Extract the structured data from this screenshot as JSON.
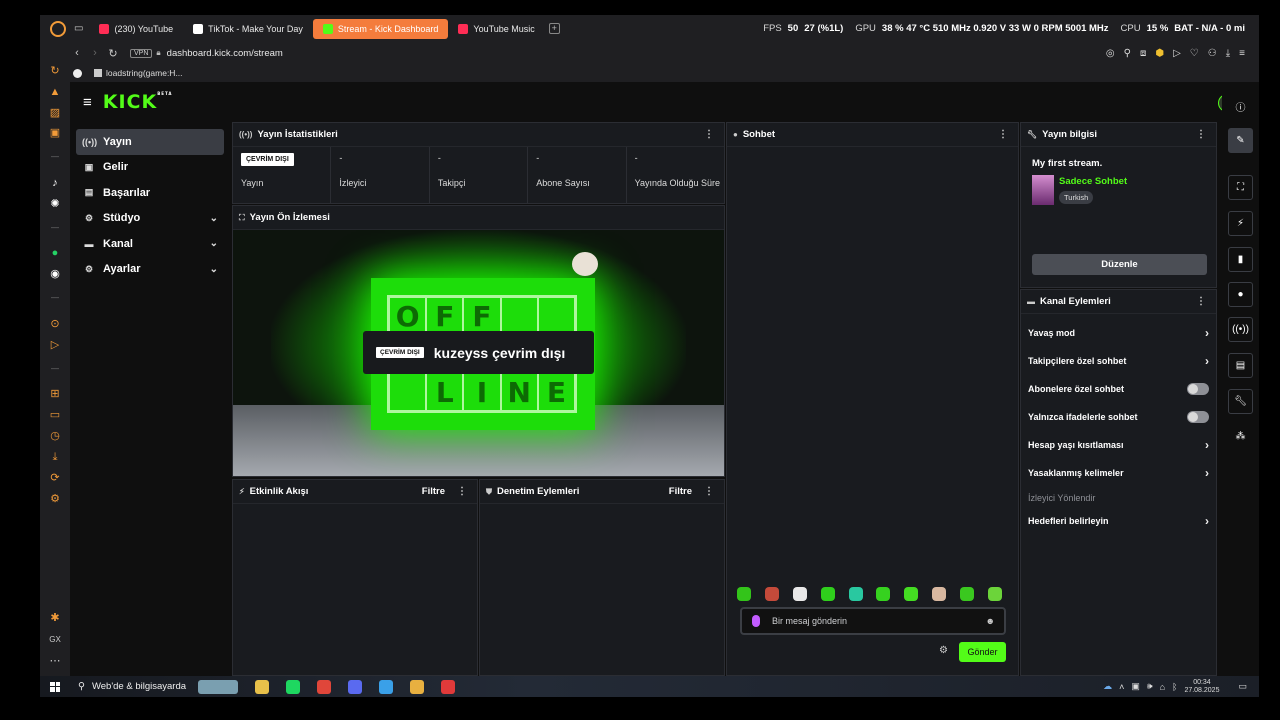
{
  "browser": {
    "tabs": [
      {
        "label": "(230) YouTube",
        "icon": "youtube-icon",
        "color": "#ff2d55",
        "active": false
      },
      {
        "label": "TikTok - Make Your Day",
        "icon": "tiktok-icon",
        "color": "#ffffff",
        "active": false
      },
      {
        "label": "Stream - Kick Dashboard",
        "icon": "kick-icon",
        "color": "#53fc18",
        "active": true
      },
      {
        "label": "YouTube Music",
        "icon": "youtube-music-icon",
        "color": "#ff2d55",
        "active": false
      }
    ],
    "add_tab": "+",
    "perf": {
      "fps_label": "FPS",
      "fps": "50",
      "fps_low": "27 (%1L)",
      "gpu_label": "GPU",
      "gpu": "38 % 47 °C 510 MHz 0.920 V 33 W 0 RPM 5001 MHz",
      "cpu_label": "CPU",
      "cpu": "15 %",
      "bat": "BAT - N/A - 0 mi"
    },
    "url": "dashboard.kick.com/stream",
    "vpn": "VPN",
    "bookmark": "loadstring(game:H..."
  },
  "kick": {
    "logo": "KICK",
    "logo_sup": "BETA",
    "nav": [
      {
        "label": "Yayın",
        "icon": "broadcast-icon",
        "active": true,
        "chevron": false
      },
      {
        "label": "Gelir",
        "icon": "dollar-icon",
        "active": false,
        "chevron": false
      },
      {
        "label": "Başarılar",
        "icon": "trophy-icon",
        "active": false,
        "chevron": false
      },
      {
        "label": "Stüdyo",
        "icon": "studio-icon",
        "active": false,
        "chevron": true
      },
      {
        "label": "Kanal",
        "icon": "channel-icon",
        "active": false,
        "chevron": true
      },
      {
        "label": "Ayarlar",
        "icon": "settings-icon",
        "active": false,
        "chevron": true
      }
    ],
    "stats": {
      "title": "Yayın İstatistikleri",
      "items": [
        {
          "value": "ÇEVRİM DIŞI",
          "label": "Yayın"
        },
        {
          "value": "-",
          "label": "İzleyici"
        },
        {
          "value": "-",
          "label": "Takipçi"
        },
        {
          "value": "-",
          "label": "Abone Sayısı"
        },
        {
          "value": "-",
          "label": "Yayında Olduğu Süre"
        }
      ]
    },
    "preview": {
      "title": "Yayın Ön İzlemesi",
      "badge": "ÇEVRİM DIŞI",
      "message": "kuzeyss çevrim dışı",
      "letters": [
        "O",
        "F",
        "F",
        "",
        "",
        "",
        "",
        "",
        "",
        "",
        "",
        "L",
        "I",
        "N",
        "E"
      ]
    },
    "activity": {
      "title": "Etkinlik Akışı",
      "filter": "Filtre"
    },
    "moderation": {
      "title": "Denetim Eylemleri",
      "filter": "Filtre"
    },
    "chat": {
      "title": "Sohbet",
      "placeholder": "Bir mesaj gönderin",
      "send": "Gönder",
      "emote_colors": [
        "#33c41a",
        "#c44a3a",
        "#e8e8e8",
        "#2fcf1c",
        "#29c8a0",
        "#36d21f",
        "#44dd22",
        "#d8b8a0",
        "#3ac81f",
        "#6cd43a"
      ]
    },
    "stream_info": {
      "title": "Yayın bilgisi",
      "stream_title": "My first stream.",
      "category": "Sadece Sohbet",
      "language": "Turkish",
      "edit": "Düzenle"
    },
    "channel_actions": {
      "title": "Kanal Eylemleri",
      "items": [
        {
          "label": "Yavaş mod",
          "type": "arrow"
        },
        {
          "label": "Takipçilere özel sohbet",
          "type": "arrow"
        },
        {
          "label": "Abonelere özel sohbet",
          "type": "toggle"
        },
        {
          "label": "Yalnızca ifadelerle sohbet",
          "type": "toggle"
        },
        {
          "label": "Hesap yaşı kısıtlaması",
          "type": "arrow"
        },
        {
          "label": "Yasaklanmış kelimeler",
          "type": "arrow"
        }
      ],
      "subheading": "İzleyici Yönlendir",
      "targets": "Hedefleri belirleyin"
    }
  },
  "taskbar": {
    "search": "Web'de & bilgisayarda",
    "time": "00:34",
    "date": "27.08.2025",
    "apps": [
      "#7a9fb0",
      "#e8c04a",
      "#1ed760",
      "#e0463a",
      "#5a6af0",
      "#3aa0e8",
      "#e8b040",
      "#e03a3a"
    ]
  }
}
